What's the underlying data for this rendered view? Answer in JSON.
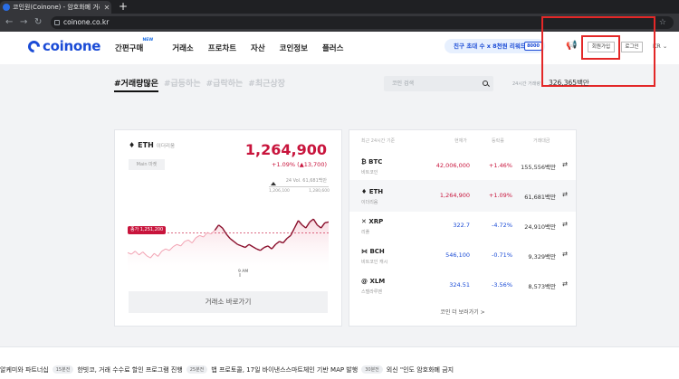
{
  "browser": {
    "tab_title": "코인원(Coinone) - 암호화폐 거래소",
    "url": "coinone.co.kr"
  },
  "header": {
    "logo_text": "coinone",
    "nav": [
      {
        "label": "간편구매",
        "badge": "NEW"
      },
      {
        "label": "거래소"
      },
      {
        "label": "프로차트"
      },
      {
        "label": "자산"
      },
      {
        "label": "코인정보"
      },
      {
        "label": "플러스"
      }
    ],
    "promo_text": "친구 초대 수 x 8천원 리워드",
    "promo_badge": "8000",
    "signup_label": "회원가입",
    "login_label": "로그인",
    "lang_label": "KR"
  },
  "filters": [
    {
      "label": "#거래량많은",
      "active": true
    },
    {
      "label": "#급등하는",
      "active": false
    },
    {
      "label": "#급락하는",
      "active": false
    },
    {
      "label": "#최근상장",
      "active": false
    }
  ],
  "search": {
    "placeholder": "코인 검색"
  },
  "total_volume": {
    "label": "24시간 거래량",
    "value": "326,365백만"
  },
  "featured": {
    "symbol": "ETH",
    "name": "이더리움",
    "market": "Main 마켓",
    "price": "1,264,900",
    "change": "+1.09% (▲13,700)",
    "volume": "24 Vol. 61,681백만",
    "range_low": "1,206,100",
    "range_high": "1,280,600",
    "prev_close_label": "종가 1,251,200",
    "time_label": "9 AM",
    "exchange_button": "거래소 바로가기"
  },
  "chart_data": {
    "type": "line",
    "title": "",
    "xlabel": "",
    "ylabel": "",
    "x_ticks": [
      "9 AM"
    ],
    "ylim": [
      1206100,
      1280600
    ],
    "reference_line": {
      "label": "종가",
      "value": 1251200
    },
    "series": [
      {
        "values": [
          1225000,
          1223000,
          1227000,
          1222000,
          1226000,
          1221000,
          1218000,
          1224000,
          1220000,
          1227000,
          1230000,
          1228000,
          1233000,
          1236000,
          1234000,
          1240000,
          1242000,
          1238000,
          1245000,
          1248000,
          1246000,
          1252000,
          1250000,
          1255000,
          1262000,
          1258000,
          1250000,
          1244000,
          1240000,
          1236000,
          1234000,
          1232000,
          1236000,
          1233000,
          1230000,
          1228000,
          1232000,
          1234000,
          1230000,
          1236000,
          1240000,
          1238000,
          1244000,
          1248000,
          1258000,
          1268000,
          1262000,
          1258000,
          1266000,
          1270000,
          1262000,
          1258000,
          1264900,
          1266000
        ]
      }
    ]
  },
  "table": {
    "header_label": "최근 24시간 기준",
    "columns": [
      "현재가",
      "등락률",
      "거래대금"
    ],
    "rows": [
      {
        "symbol": "BTC",
        "icon": "bitcoin-icon",
        "name": "비트코인",
        "price": "42,006,000",
        "change": "+1.46%",
        "volume": "155,556백만",
        "dir": "up"
      },
      {
        "symbol": "ETH",
        "icon": "ethereum-icon",
        "name": "이더리움",
        "price": "1,264,900",
        "change": "+1.09%",
        "volume": "61,681백만",
        "dir": "up"
      },
      {
        "symbol": "XRP",
        "icon": "ripple-icon",
        "name": "리플",
        "price": "322.7",
        "change": "-4.72%",
        "volume": "24,910백만",
        "dir": "down"
      },
      {
        "symbol": "BCH",
        "icon": "bitcoin-cash-icon",
        "name": "비트코인 캐시",
        "price": "546,100",
        "change": "-0.71%",
        "volume": "9,329백만",
        "dir": "down"
      },
      {
        "symbol": "XLM",
        "icon": "stellar-icon",
        "name": "스텔라루멘",
        "price": "324.51",
        "change": "-3.56%",
        "volume": "8,573백만",
        "dir": "down"
      }
    ],
    "more_label": "코인 더 보러가기 >"
  },
  "ticker": [
    {
      "text": "알케미와 파트너십",
      "badge": "15분전"
    },
    {
      "text": "한빗코, 거래 수수료 할인 프로그램 진행",
      "badge": "25분전"
    },
    {
      "text": "뱁 프로토콜, 17일 바이낸스스마트체인 기반 MAP 발행",
      "badge": "30분전"
    },
    {
      "text": "외신 \"인도 암호화폐 금지",
      "badge": ""
    }
  ],
  "colors": {
    "brand": "#1a4bd6",
    "up": "#c8143c",
    "down": "#1a4bd6",
    "annotation": "#e32727"
  }
}
